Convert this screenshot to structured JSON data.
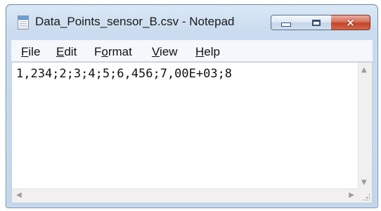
{
  "window": {
    "title": "Data_Points_sensor_B.csv - Notepad",
    "controls": {
      "minimize": "minimize",
      "maximize": "maximize",
      "close": "×"
    }
  },
  "menu": [
    {
      "mnemonic": "F",
      "rest": "ile"
    },
    {
      "mnemonic": "E",
      "rest": "dit"
    },
    {
      "pre": "F",
      "mnemonic": "o",
      "rest": "rmat"
    },
    {
      "mnemonic": "V",
      "rest": "iew"
    },
    {
      "mnemonic": "H",
      "rest": "elp"
    }
  ],
  "editor": {
    "text": "1,234;2;3;4;5;6,456;7,00E+03;8"
  },
  "scrollbars": {
    "up": "▲",
    "down": "▼",
    "left": "◀",
    "right": "▶"
  },
  "icons": {
    "app": "notepad-icon",
    "minimize": "minimize-icon",
    "maximize": "maximize-icon",
    "close": "close-icon"
  },
  "colors": {
    "titlebar": "#c9dbee",
    "close_button": "#c2452b",
    "menubar": "#f4f7fb",
    "editor_bg": "#ffffff"
  }
}
